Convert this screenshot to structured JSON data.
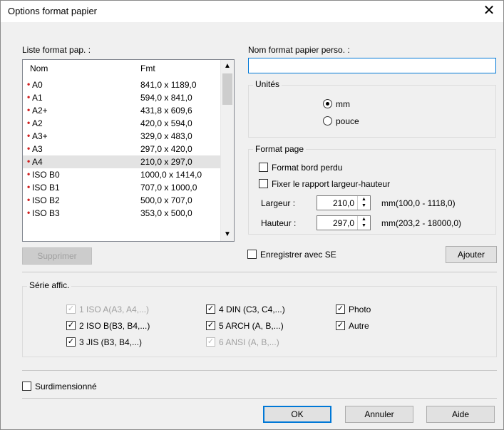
{
  "window": {
    "title": "Options format papier",
    "close_glyph": "✕"
  },
  "paper_list": {
    "label": "Liste format pap. :",
    "columns": [
      "Nom",
      "Fmt"
    ],
    "rows": [
      {
        "name": "A0",
        "size": "841,0 x 1189,0"
      },
      {
        "name": "A1",
        "size": "594,0 x 841,0"
      },
      {
        "name": "A2+",
        "size": "431,8 x 609,6"
      },
      {
        "name": "A2",
        "size": "420,0 x 594,0"
      },
      {
        "name": "A3+",
        "size": "329,0 x 483,0"
      },
      {
        "name": "A3",
        "size": "297,0 x 420,0"
      },
      {
        "name": "A4",
        "size": "210,0 x 297,0"
      },
      {
        "name": "ISO B0",
        "size": "1000,0 x 1414,0"
      },
      {
        "name": "ISO B1",
        "size": "707,0 x 1000,0"
      },
      {
        "name": "ISO B2",
        "size": "500,0 x 707,0"
      },
      {
        "name": "ISO B3",
        "size": "353,0 x 500,0"
      }
    ],
    "selected_index": 6,
    "delete_button": "Supprimer"
  },
  "custom_name": {
    "label": "Nom format papier perso. :",
    "value": ""
  },
  "units": {
    "title": "Unités",
    "options": [
      "mm",
      "pouce"
    ],
    "selected": "mm"
  },
  "page_format": {
    "title": "Format page",
    "borderless_label": "Format bord perdu",
    "fix_ratio_label": "Fixer le rapport largeur-hauteur",
    "width_label": "Largeur :",
    "width_value": "210,0",
    "width_range": "mm(100,0 - 1118,0)",
    "height_label": "Hauteur :",
    "height_value": "297,0",
    "height_range": "mm(203,2 - 18000,0)"
  },
  "save_with_os_label": "Enregistrer avec SE",
  "add_button": "Ajouter",
  "display_series": {
    "title": "Série affic.",
    "items": [
      {
        "label": "1 ISO A(A3, A4,...)",
        "checked": true,
        "enabled": false
      },
      {
        "label": "2 ISO B(B3, B4,...)",
        "checked": true,
        "enabled": true
      },
      {
        "label": "3 JIS (B3, B4,...)",
        "checked": true,
        "enabled": true
      },
      {
        "label": "4 DIN (C3, C4,...)",
        "checked": true,
        "enabled": true
      },
      {
        "label": "5 ARCH (A, B,...)",
        "checked": true,
        "enabled": true
      },
      {
        "label": "6 ANSI (A, B,...)",
        "checked": true,
        "enabled": false
      },
      {
        "label": "Photo",
        "checked": true,
        "enabled": true
      },
      {
        "label": "Autre",
        "checked": true,
        "enabled": true
      }
    ]
  },
  "oversize_label": "Surdimensionné",
  "footer": {
    "ok": "OK",
    "cancel": "Annuler",
    "help": "Aide"
  },
  "icons": {
    "bullet": "red-dot-icon",
    "check": "check-icon",
    "spin": "spinner-arrows-icon"
  }
}
